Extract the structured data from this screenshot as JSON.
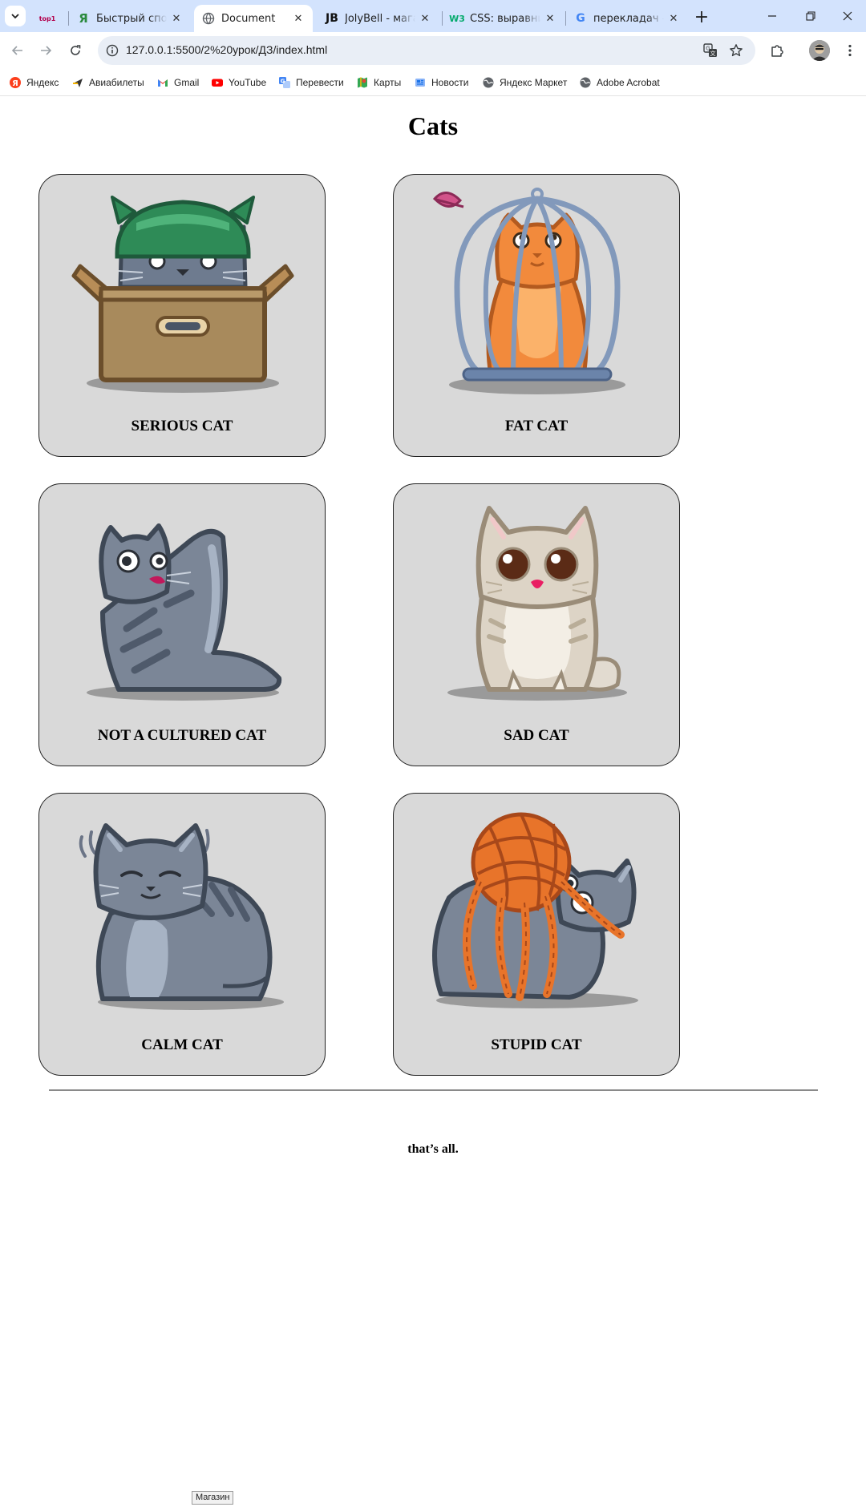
{
  "browser": {
    "tabs": [
      {
        "label": "",
        "favicon_text": "top1",
        "active": false
      },
      {
        "label": "Быстрый способ",
        "favicon_text": "Я",
        "active": false
      },
      {
        "label": "Document",
        "favicon_text": "",
        "active": true
      },
      {
        "label": "JolyBell - магазин",
        "favicon_text": "JB",
        "active": false
      },
      {
        "label": "CSS: выравнивание",
        "favicon_text": "W3",
        "active": false
      },
      {
        "label": "перекладач - Поиск",
        "favicon_text": "G",
        "active": false
      }
    ],
    "url": "127.0.0.1:5500/2%20урок/ДЗ/index.html",
    "bookmarks": [
      {
        "label": "Яндекс",
        "icon": "yandex-icon"
      },
      {
        "label": "Авиабилеты",
        "icon": "plane-icon"
      },
      {
        "label": "Gmail",
        "icon": "gmail-icon"
      },
      {
        "label": "YouTube",
        "icon": "youtube-icon"
      },
      {
        "label": "Перевести",
        "icon": "translate-icon"
      },
      {
        "label": "Карты",
        "icon": "maps-icon"
      },
      {
        "label": "Новости",
        "icon": "news-icon"
      },
      {
        "label": "Яндекс Маркет",
        "icon": "globe-icon"
      },
      {
        "label": "Adobe Acrobat",
        "icon": "globe-icon"
      }
    ],
    "status_tooltip": "Магазин"
  },
  "page": {
    "title": "Cats",
    "cards": [
      {
        "caption": "SERIOUS CAT",
        "image": "cat-in-box-with-helmet"
      },
      {
        "caption": "FAT CAT",
        "image": "orange-cat-in-cage"
      },
      {
        "caption": "NOT A CULTURED CAT",
        "image": "gray-cat-licking"
      },
      {
        "caption": "SAD CAT",
        "image": "beige-cat-big-eyes"
      },
      {
        "caption": "CALM CAT",
        "image": "gray-cat-eyes-closed"
      },
      {
        "caption": "STUPID CAT",
        "image": "gray-cat-tangled-yarn"
      }
    ],
    "footer": "that’s all."
  }
}
